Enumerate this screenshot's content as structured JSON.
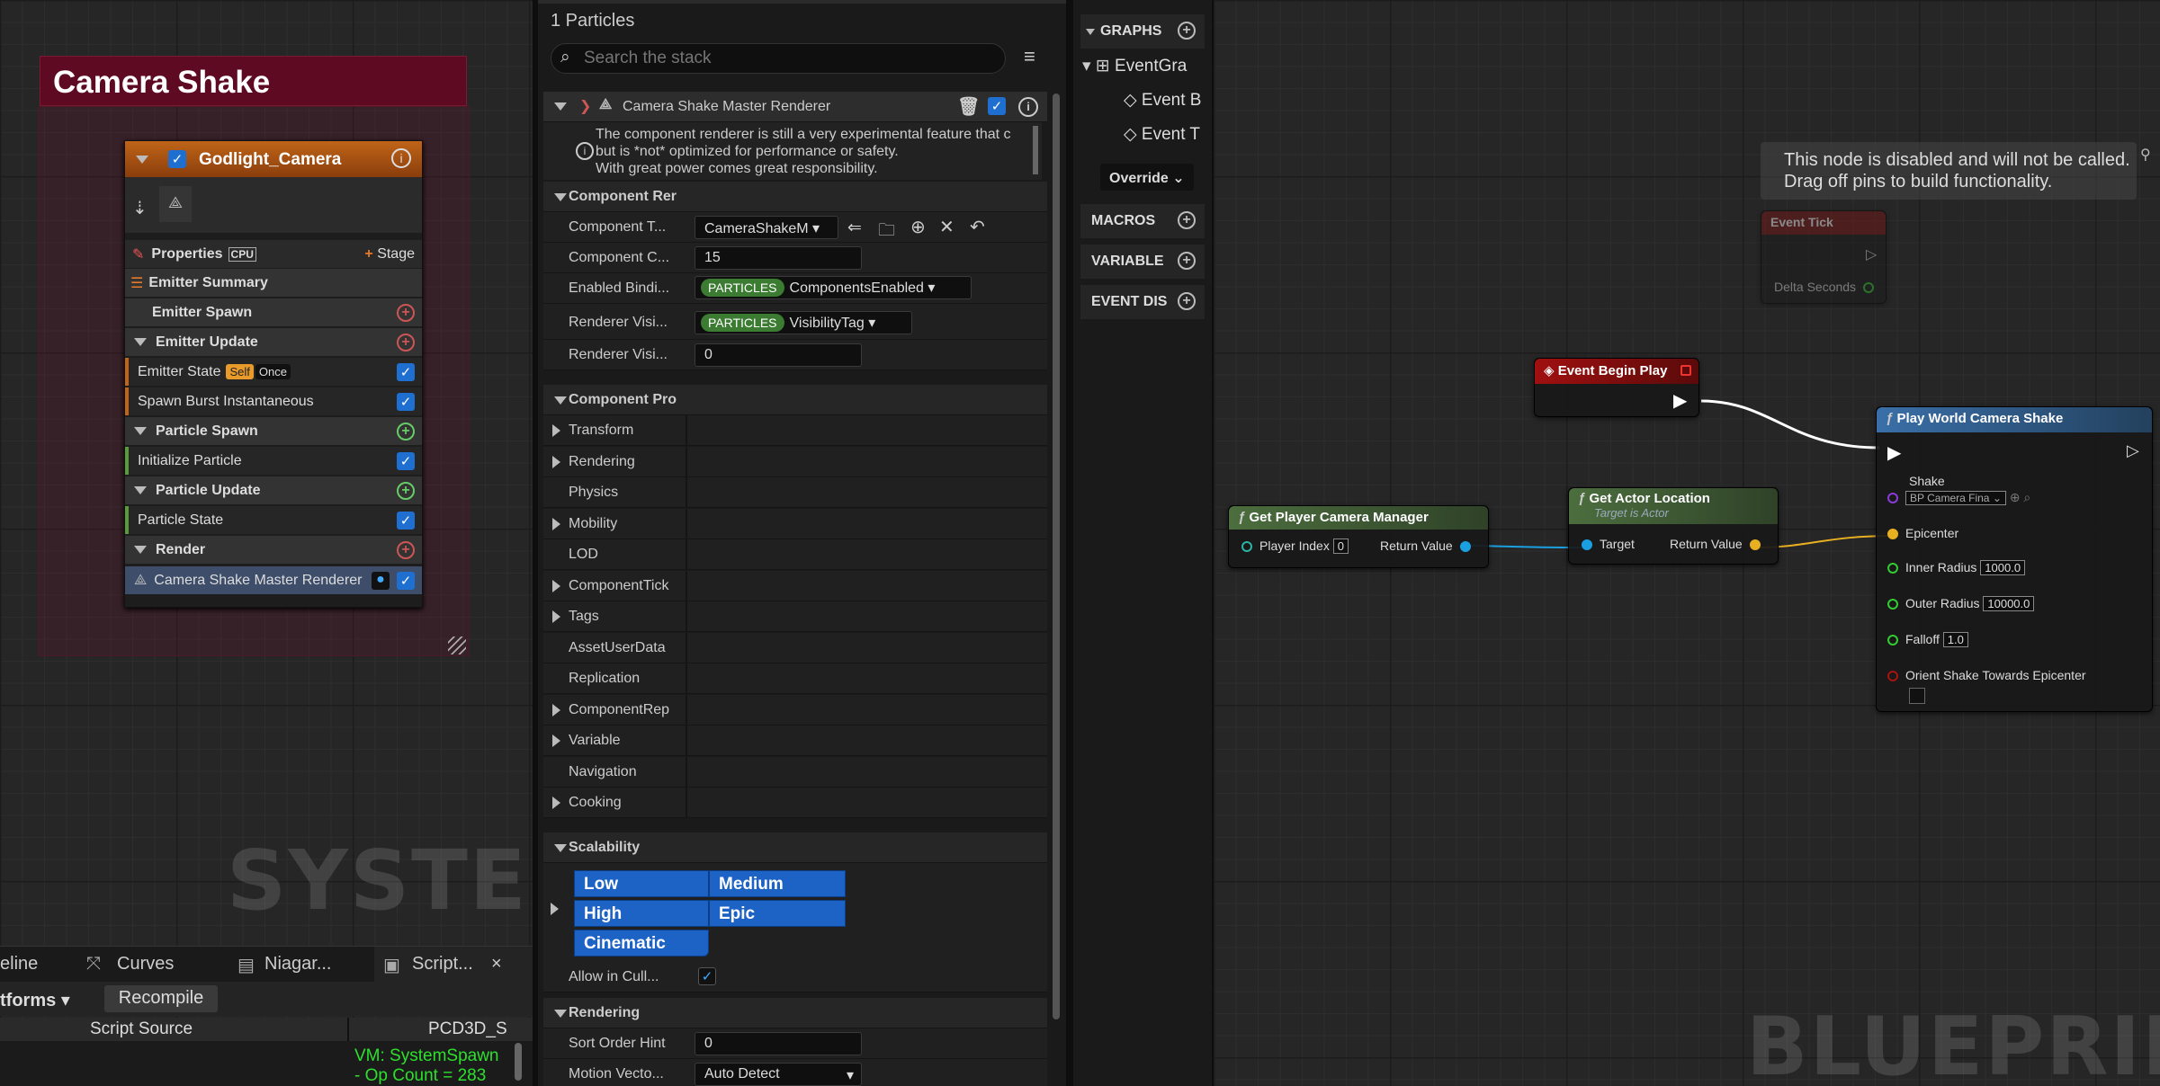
{
  "system_overview": {
    "title": "Camera Shake",
    "watermark": "SYSTEM",
    "emitter": {
      "name": "Godlight_Camera",
      "properties_label": "Properties",
      "cpu_label": "CPU",
      "stage_label": "Stage",
      "rows": [
        {
          "label": "Emitter Summary"
        },
        {
          "label": "Emitter Spawn"
        },
        {
          "label": "Emitter Update"
        },
        {
          "label": "Emitter State",
          "badge1": "Self",
          "badge2": "Once"
        },
        {
          "label": "Spawn Burst Instantaneous"
        },
        {
          "label": "Particle Spawn"
        },
        {
          "label": "Initialize Particle"
        },
        {
          "label": "Particle Update"
        },
        {
          "label": "Particle State"
        },
        {
          "label": "Render"
        },
        {
          "label": "Camera Shake Master Renderer"
        }
      ]
    }
  },
  "bottom_tabs": [
    {
      "label": "eline"
    },
    {
      "label": "Curves"
    },
    {
      "label": "Niagar..."
    },
    {
      "label": "Script..."
    }
  ],
  "script_toolbar": {
    "platforms": "tforms",
    "recompile": "Recompile"
  },
  "script_table": {
    "col1": "Script Source",
    "col2": "PCD3D_S",
    "vm_line1": "VM: SystemSpawn",
    "vm_line2": "- Op Count = 283"
  },
  "stack": {
    "particle_count": "1 Particles",
    "search_placeholder": "Search the stack",
    "renderer_title": "Camera Shake Master Renderer",
    "warning": [
      "The component renderer is still a very experimental feature that c",
      "but is *not* optimized for performance or safety.",
      "With great power comes great responsibility."
    ],
    "sections": {
      "component_renderer": "Component Rer",
      "component_properties": "Component Pro",
      "scalability": "Scalability",
      "rendering": "Rendering"
    },
    "component_props": [
      {
        "label": "Component T...",
        "value": "CameraShakeM"
      },
      {
        "label": "Component C...",
        "value": "15"
      },
      {
        "label": "Enabled Bindi...",
        "pill": "PARTICLES",
        "value": "ComponentsEnabled"
      },
      {
        "label": "Renderer Visi...",
        "pill": "PARTICLES",
        "value": "VisibilityTag"
      },
      {
        "label": "Renderer Visi...",
        "value": "0"
      }
    ],
    "categories": [
      "Transform",
      "Rendering",
      "Physics",
      "Mobility",
      "LOD",
      "ComponentTick",
      "Tags",
      "AssetUserData",
      "Replication",
      "ComponentRep",
      "Variable",
      "Navigation",
      "Cooking"
    ],
    "scalability_buttons": [
      "Low",
      "Medium",
      "High",
      "Epic",
      "Cinematic"
    ],
    "allow_in_cull": "Allow in Cull...",
    "rendering_props": [
      {
        "label": "Sort Order Hint",
        "value": "0"
      },
      {
        "label": "Motion Vecto...",
        "value": "Auto Detect"
      }
    ]
  },
  "my_blueprint": {
    "graphs": "GRAPHS",
    "event_graph": "EventGra",
    "events": [
      "Event B",
      "Event T"
    ],
    "override": "Override",
    "macros": "MACROS",
    "variables": "VARIABLE",
    "dispatchers": "EVENT DIS"
  },
  "graph": {
    "watermark": "BLUEPRINT",
    "disabled_note": [
      "This node is disabled and will not be called.",
      "Drag off pins to build functionality."
    ],
    "event_tick": {
      "title": "Event Tick",
      "pin": "Delta Seconds"
    },
    "begin_play": {
      "title": "Event Begin Play"
    },
    "camera_manager": {
      "title": "Get Player Camera Manager",
      "in_label": "Player Index",
      "in_value": "0",
      "out_label": "Return Value"
    },
    "actor_location": {
      "title": "Get Actor Location",
      "subtitle": "Target is Actor",
      "in_label": "Target",
      "out_label": "Return Value"
    },
    "play_shake": {
      "title": "Play World Camera Shake",
      "shake_label": "Shake",
      "shake_value": "BP Camera Fina",
      "epicenter": "Epicenter",
      "inner_label": "Inner Radius",
      "inner_value": "1000.0",
      "outer_label": "Outer Radius",
      "outer_value": "10000.0",
      "falloff_label": "Falloff",
      "falloff_value": "1.0",
      "orient_label": "Orient Shake Towards Epicenter"
    }
  }
}
